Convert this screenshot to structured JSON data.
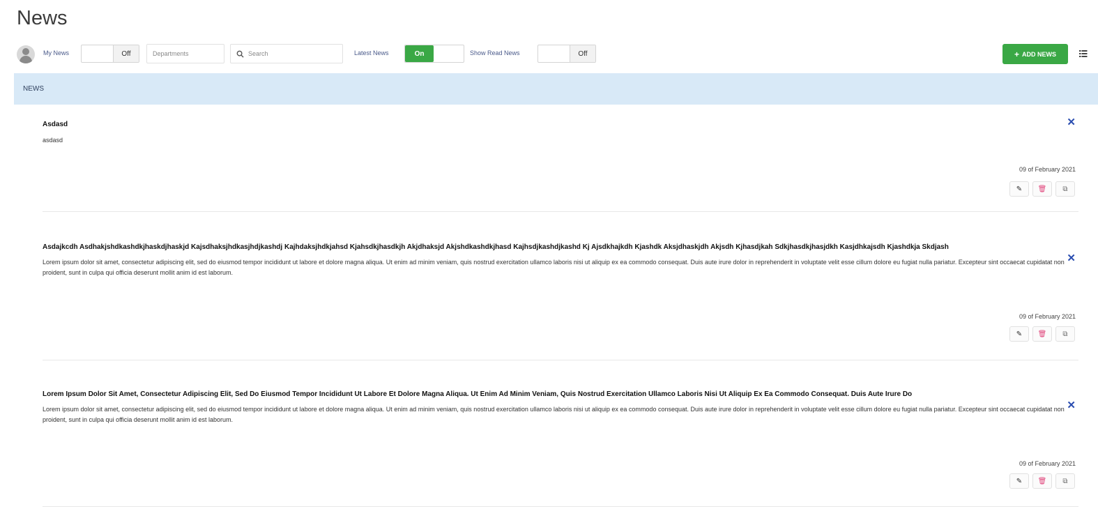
{
  "page_title": "News",
  "toolbar": {
    "my_news_label": "My News",
    "my_news_toggle": {
      "on_text": "",
      "off_text": "Off"
    },
    "departments_placeholder": "Departments",
    "search_placeholder": "Search",
    "latest_news_label": "Latest News",
    "latest_news_toggle": {
      "on_text": "On",
      "off_text": ""
    },
    "show_read_label": "Show Read News",
    "show_read_toggle": {
      "on_text": "",
      "off_text": "Off"
    },
    "add_news_label": "ADD NEWS",
    "add_news_icon": "plus-icon",
    "view_icon": "list-view-icon"
  },
  "section": {
    "title": "NEWS"
  },
  "news_items": [
    {
      "title": "Asdasd",
      "body": "asdasd",
      "date": "09 of February 2021"
    },
    {
      "title": "Asdajkcdh Asdhakjshdkashdkjhaskdjhaskjd Kajsdhaksjhdkasjhdjkashdj Kajhdaksjhdkjahsd Kjahsdkjhasdkjh Akjdhaksjd Akjshdkashdkjhasd Kajhsdjkashdjkashd Kj Ajsdkhajkdh Kjashdk Aksjdhaskjdh Akjsdh Kjhasdjkah Sdkjhasdkjhasjdkh Kasjdhkajsdh Kjashdkja Skdjash",
      "body": "Lorem ipsum dolor sit amet, consectetur adipiscing elit, sed do eiusmod tempor incididunt ut labore et dolore magna aliqua. Ut enim ad minim veniam, quis nostrud exercitation ullamco laboris nisi ut aliquip ex ea commodo consequat. Duis aute irure dolor in reprehenderit in voluptate velit esse cillum dolore eu fugiat nulla pariatur. Excepteur sint occaecat cupidatat non proident, sunt in culpa qui officia deserunt mollit anim id est laborum.",
      "date": "09 of February 2021"
    },
    {
      "title": "Lorem Ipsum Dolor Sit Amet, Consectetur Adipiscing Elit, Sed Do Eiusmod Tempor Incididunt Ut Labore Et Dolore Magna Aliqua. Ut Enim Ad Minim Veniam, Quis Nostrud Exercitation Ullamco Laboris Nisi Ut Aliquip Ex Ea Commodo Consequat. Duis Aute Irure Do",
      "body": "Lorem ipsum dolor sit amet, consectetur adipiscing elit, sed do eiusmod tempor incididunt ut labore et dolore magna aliqua. Ut enim ad minim veniam, quis nostrud exercitation ullamco laboris nisi ut aliquip ex ea commodo consequat. Duis aute irure dolor in reprehenderit in voluptate velit esse cillum dolore eu fugiat nulla pariatur. Excepteur sint occaecat cupidatat non proident, sunt in culpa qui officia deserunt mollit anim id est laborum.",
      "date": "09 of February 2021"
    }
  ],
  "item_action_icons": [
    "edit-icon",
    "delete-icon",
    "copy-icon"
  ],
  "colors": {
    "accent_green": "#3aa845",
    "header_blue": "#d8e9f7",
    "close_blue": "#2a4db0",
    "delete_pink": "#e0457b"
  }
}
